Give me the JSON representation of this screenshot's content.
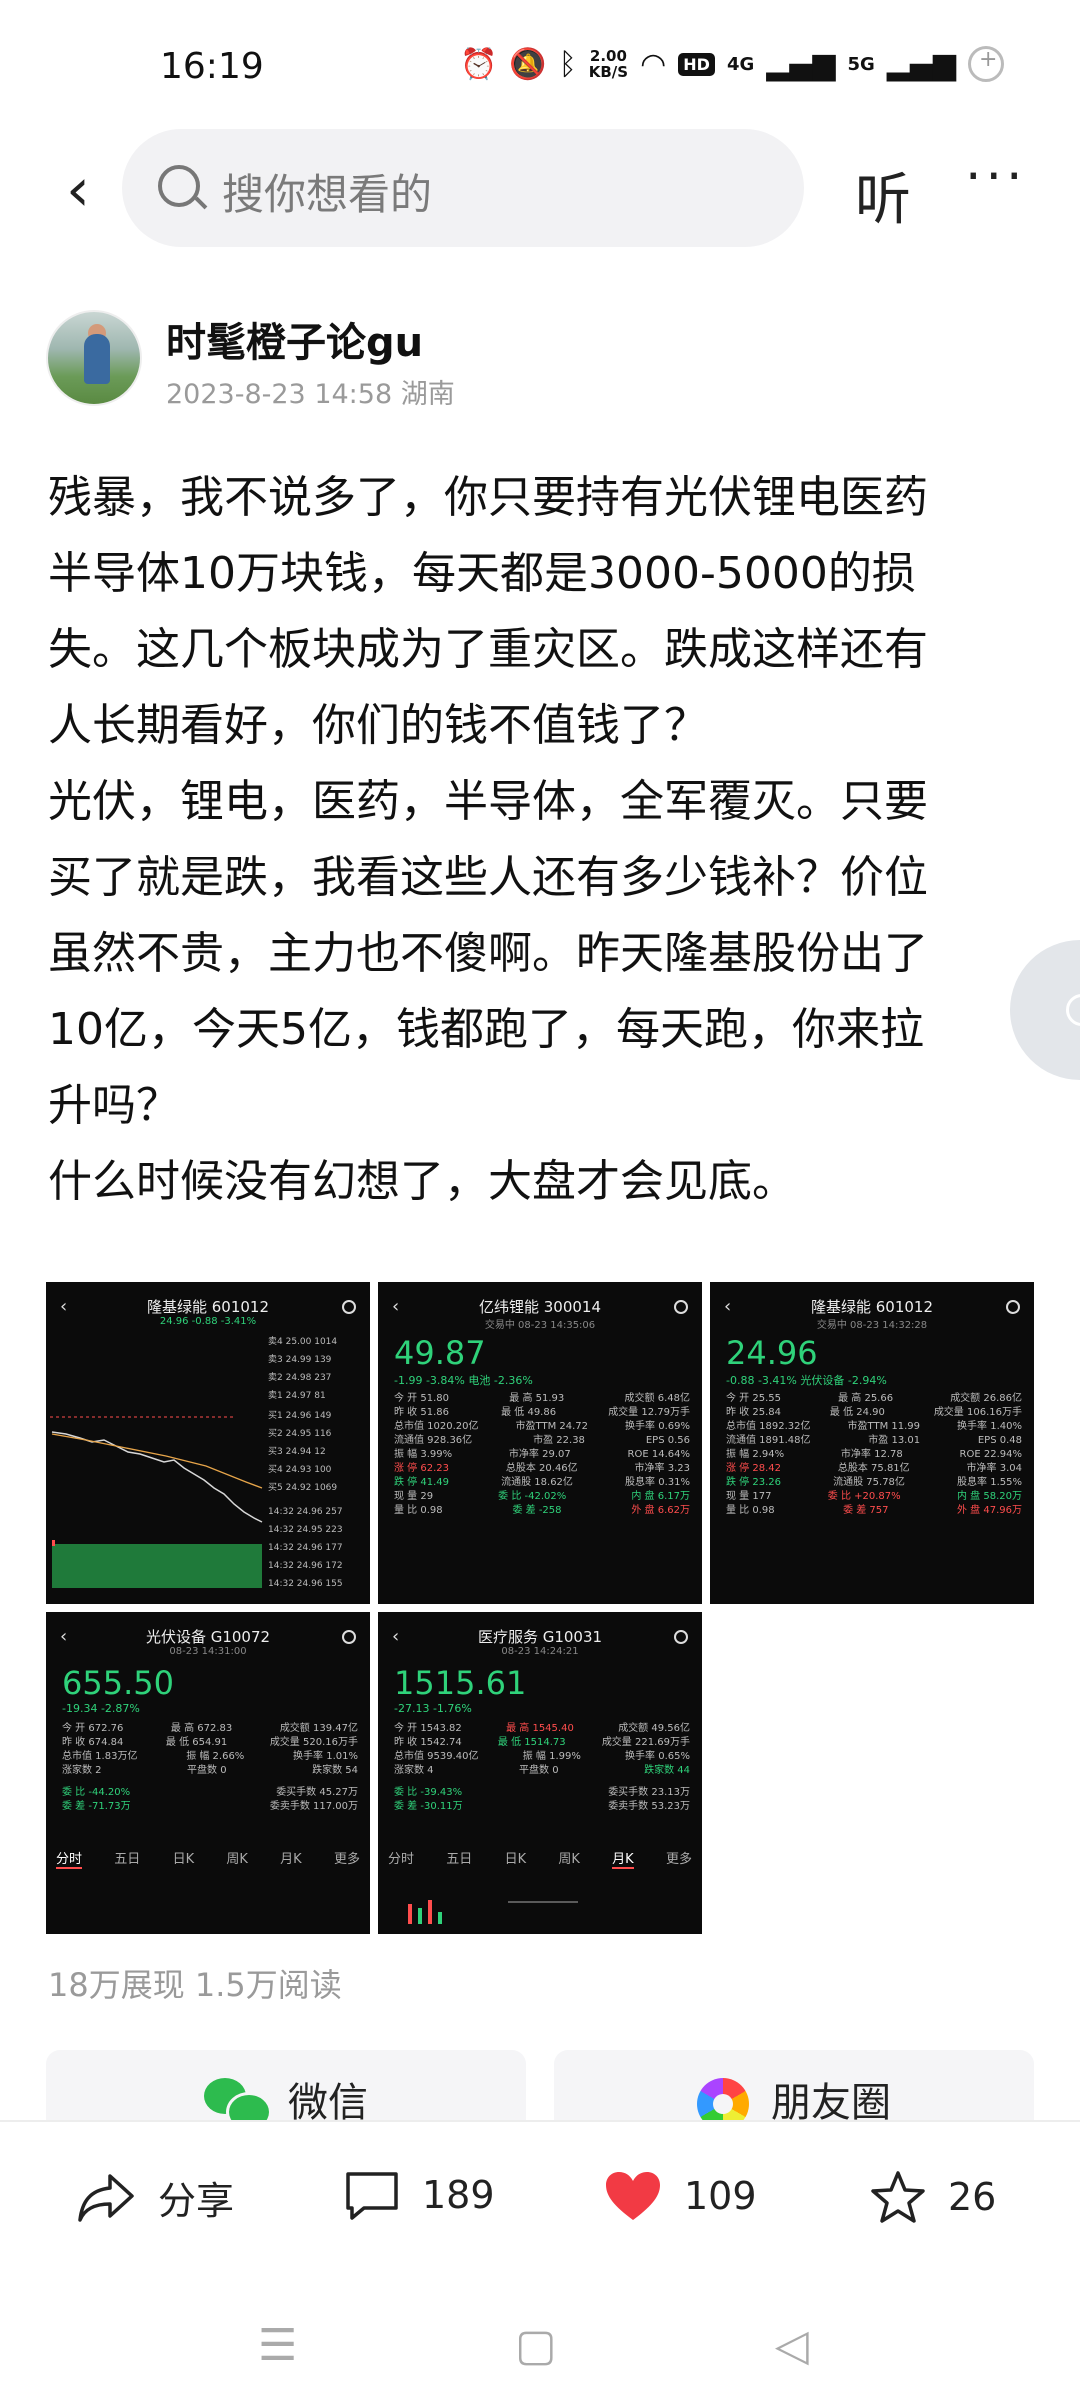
{
  "status_bar": {
    "time": "16:19",
    "net_speed_value": "2.00",
    "net_speed_unit": "KB/S",
    "hd": "HD",
    "signal1": "4G",
    "signal2": "5G"
  },
  "topbar": {
    "back_icon": "‹",
    "search_placeholder": "搜你想看的",
    "listen_label": "听",
    "more_icon": "···"
  },
  "author": {
    "name": "时髦橙子论gu",
    "meta": "2023-8-23 14:58 湖南"
  },
  "post": {
    "lines": [
      "残暴，我不说多了，你只要持有光伏锂电医药",
      "半导体10万块钱，每天都是3000-5000的损",
      "失。这几个板块成为了重灾区。跌成这样还有",
      "人长期看好，你们的钱不值钱了？",
      " 光伏，锂电，医药，半导体，全军覆灭。只要",
      "买了就是跌，我看这些人还有多少钱补？价位",
      "虽然不贵，主力也不傻啊。昨天隆基股份出了",
      "10亿，今天5亿，钱都跑了，每天跑，你来拉",
      "升吗？",
      " 什么时候没有幻想了，大盘才会见底。"
    ]
  },
  "images": [
    {
      "title": "隆基绿能 601012",
      "sub": "24.96 -0.88 -3.41%",
      "price": "",
      "change": "",
      "kind": "chart"
    },
    {
      "title": "亿纬锂能 300014",
      "sub": "交易中 08-23 14:35:06",
      "price": "49.87",
      "change": "-1.99  -3.84%  电池 -2.36%",
      "kind": "quote"
    },
    {
      "title": "隆基绿能 601012",
      "sub": "交易中 08-23 14:32:28",
      "price": "24.96",
      "change": "-0.88  -3.41%  光伏设备 -2.94%",
      "kind": "quote"
    },
    {
      "title": "光伏设备 G10072",
      "sub": "08-23 14:31:00",
      "price": "655.50",
      "change": "-19.34  -2.87%",
      "kind": "index"
    },
    {
      "title": "医疗服务 G10031",
      "sub": "08-23 14:24:21",
      "price": "1515.61",
      "change": "-27.13  -1.76%",
      "kind": "index"
    }
  ],
  "img_rows": {
    "quote1": [
      [
        "今 开  51.80",
        "最 高  51.93",
        "成交额  6.48亿"
      ],
      [
        "昨 收  51.86",
        "最 低  49.86",
        "成交量  12.79万手"
      ],
      [
        "总市值  1020.20亿",
        "市盈TTM  24.72",
        "换手率  0.69%"
      ],
      [
        "流通值  928.36亿",
        "市盈  22.38",
        "EPS  0.56"
      ],
      [
        "振 幅  3.99%",
        "市净率  29.07",
        "ROE  14.64%"
      ],
      [
        "涨 停  62.23",
        "总股本  20.46亿",
        "市净率  3.23"
      ],
      [
        "跌 停  41.49",
        "流通股  18.62亿",
        "股息率  0.31%"
      ],
      [
        "现 量  29",
        "委 比  -42.02%",
        "内 盘  6.17万"
      ],
      [
        "量 比  0.98",
        "委 差  -258",
        "外 盘  6.62万"
      ]
    ],
    "quote2": [
      [
        "今 开  25.55",
        "最 高  25.66",
        "成交额  26.86亿"
      ],
      [
        "昨 收  25.84",
        "最 低  24.90",
        "成交量  106.16万手"
      ],
      [
        "总市值  1892.32亿",
        "市盈TTM  11.99",
        "换手率  1.40%"
      ],
      [
        "流通值  1891.48亿",
        "市盈  13.01",
        "EPS  0.48"
      ],
      [
        "振 幅  2.94%",
        "市净率  12.78",
        "ROE  22.94%"
      ],
      [
        "涨 停  28.42",
        "总股本  75.81亿",
        "市净率  3.04"
      ],
      [
        "跌 停  23.26",
        "流通股  75.78亿",
        "股息率  1.55%"
      ],
      [
        "现 量  177",
        "委 比  +20.87%",
        "内 盘  58.20万"
      ],
      [
        "量 比  0.98",
        "委 差  757",
        "外 盘  47.96万"
      ]
    ],
    "index1": [
      [
        "今 开  672.76",
        "最 高  672.83",
        "成交额  139.47亿"
      ],
      [
        "昨 收  674.84",
        "最 低  654.91",
        "成交量  520.16万手"
      ],
      [
        "总市值  1.83万亿",
        "振 幅  2.66%",
        "换手率  1.01%"
      ],
      [
        "涨家数  2",
        "平盘数  0",
        "跌家数  54"
      ],
      [
        "委 比  -44.20%",
        "委买手数  45.27万",
        ""
      ],
      [
        "委 差  -71.73万",
        "委卖手数  117.00万",
        ""
      ]
    ],
    "index2": [
      [
        "今 开  1543.82",
        "最 高  1545.40",
        "成交额  49.56亿"
      ],
      [
        "昨 收  1542.74",
        "最 低  1514.73",
        "成交量  221.69万手"
      ],
      [
        "总市值  9539.40亿",
        "振 幅  1.99%",
        "换手率  0.65%"
      ],
      [
        "涨家数  4",
        "平盘数  0",
        "跌家数  44"
      ],
      [
        "委 比  -39.43%",
        "委买手数  23.13万",
        ""
      ],
      [
        "委 差  -30.11万",
        "委卖手数  53.23万",
        ""
      ]
    ],
    "tabs": [
      "分时",
      "五日",
      "日K",
      "周K",
      "月K",
      "更多"
    ]
  },
  "stats": "18万展现  1.5万阅读",
  "share": {
    "wechat_label": "微信",
    "moments_label": "朋友圈"
  },
  "actions": {
    "share_label": "分享",
    "comment_count": "189",
    "like_count": "109",
    "fav_count": "26"
  },
  "colors": {
    "accent_red": "#f23a44",
    "stock_green": "#2fd27a",
    "wechat_green": "#2dbb4e"
  }
}
